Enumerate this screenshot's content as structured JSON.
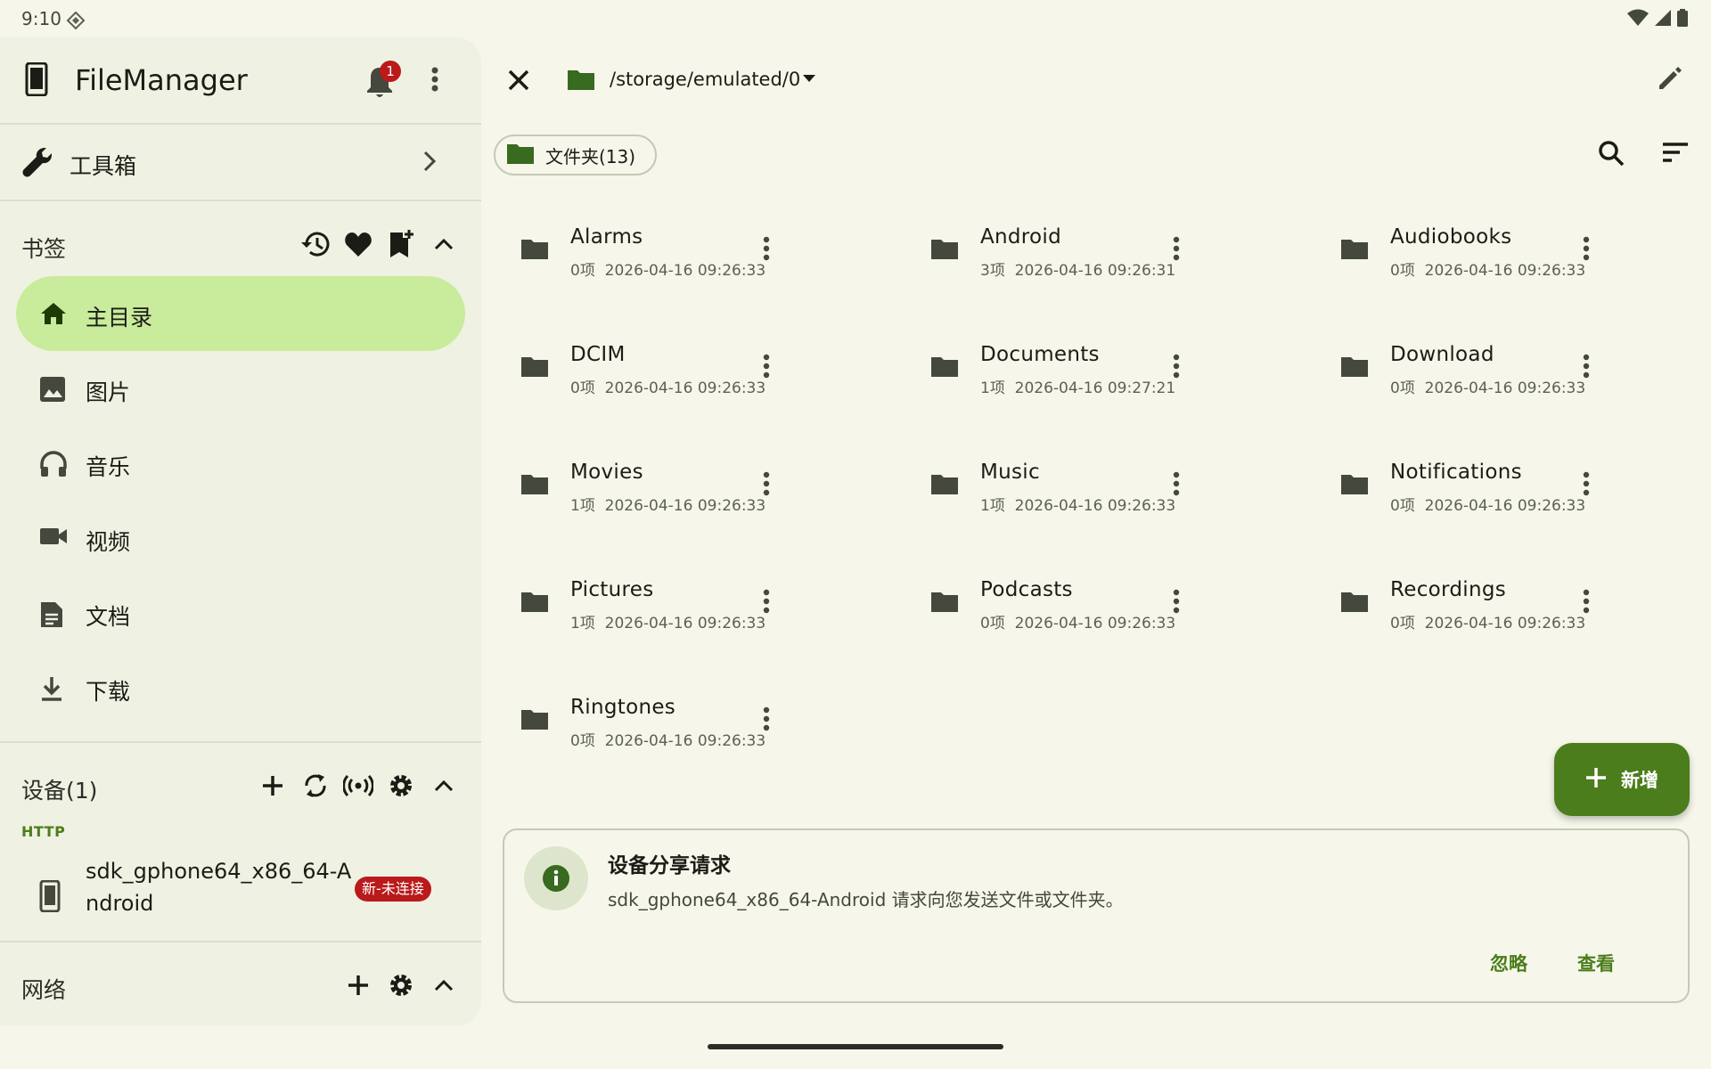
{
  "status": {
    "time": "9:10"
  },
  "drawer": {
    "app_title": "FileManager",
    "notification_count": "1",
    "toolbox_label": "工具箱",
    "bookmarks_title": "书签",
    "nav_items": [
      {
        "label": "主目录",
        "icon": "home-icon"
      },
      {
        "label": "图片",
        "icon": "image-icon"
      },
      {
        "label": "音乐",
        "icon": "headphones-icon"
      },
      {
        "label": "视频",
        "icon": "video-icon"
      },
      {
        "label": "文档",
        "icon": "document-icon"
      },
      {
        "label": "下载",
        "icon": "download-icon"
      }
    ],
    "devices_title": "设备(1)",
    "http_label": "HTTP",
    "device": {
      "name": "sdk_gphone64_x86_64-Android",
      "badge": "新-未连接"
    },
    "network_title": "网络"
  },
  "main": {
    "path": "/storage/emulated/0",
    "folder_chip": "文件夹(13)",
    "files": [
      {
        "name": "Alarms",
        "count": "0项",
        "date": "2026-04-16 09:26:33"
      },
      {
        "name": "Android",
        "count": "3项",
        "date": "2026-04-16 09:26:31"
      },
      {
        "name": "Audiobooks",
        "count": "0项",
        "date": "2026-04-16 09:26:33"
      },
      {
        "name": "DCIM",
        "count": "0项",
        "date": "2026-04-16 09:26:33"
      },
      {
        "name": "Documents",
        "count": "1项",
        "date": "2026-04-16 09:27:21"
      },
      {
        "name": "Download",
        "count": "0项",
        "date": "2026-04-16 09:26:33"
      },
      {
        "name": "Movies",
        "count": "1项",
        "date": "2026-04-16 09:26:33"
      },
      {
        "name": "Music",
        "count": "1项",
        "date": "2026-04-16 09:26:33"
      },
      {
        "name": "Notifications",
        "count": "0项",
        "date": "2026-04-16 09:26:33"
      },
      {
        "name": "Pictures",
        "count": "1项",
        "date": "2026-04-16 09:26:33"
      },
      {
        "name": "Podcasts",
        "count": "0项",
        "date": "2026-04-16 09:26:33"
      },
      {
        "name": "Recordings",
        "count": "0项",
        "date": "2026-04-16 09:26:33"
      },
      {
        "name": "Ringtones",
        "count": "0项",
        "date": "2026-04-16 09:26:33"
      }
    ],
    "fab_label": "新增",
    "notice": {
      "title": "设备分享请求",
      "body": "sdk_gphone64_x86_64-Android 请求向您发送文件或文件夹。",
      "ignore": "忽略",
      "view": "查看"
    }
  },
  "colors": {
    "accent": "#4b7d1c",
    "active_nav": "#c9eb9c",
    "badge": "#ba1a1a",
    "background": "#f6f7ea"
  }
}
